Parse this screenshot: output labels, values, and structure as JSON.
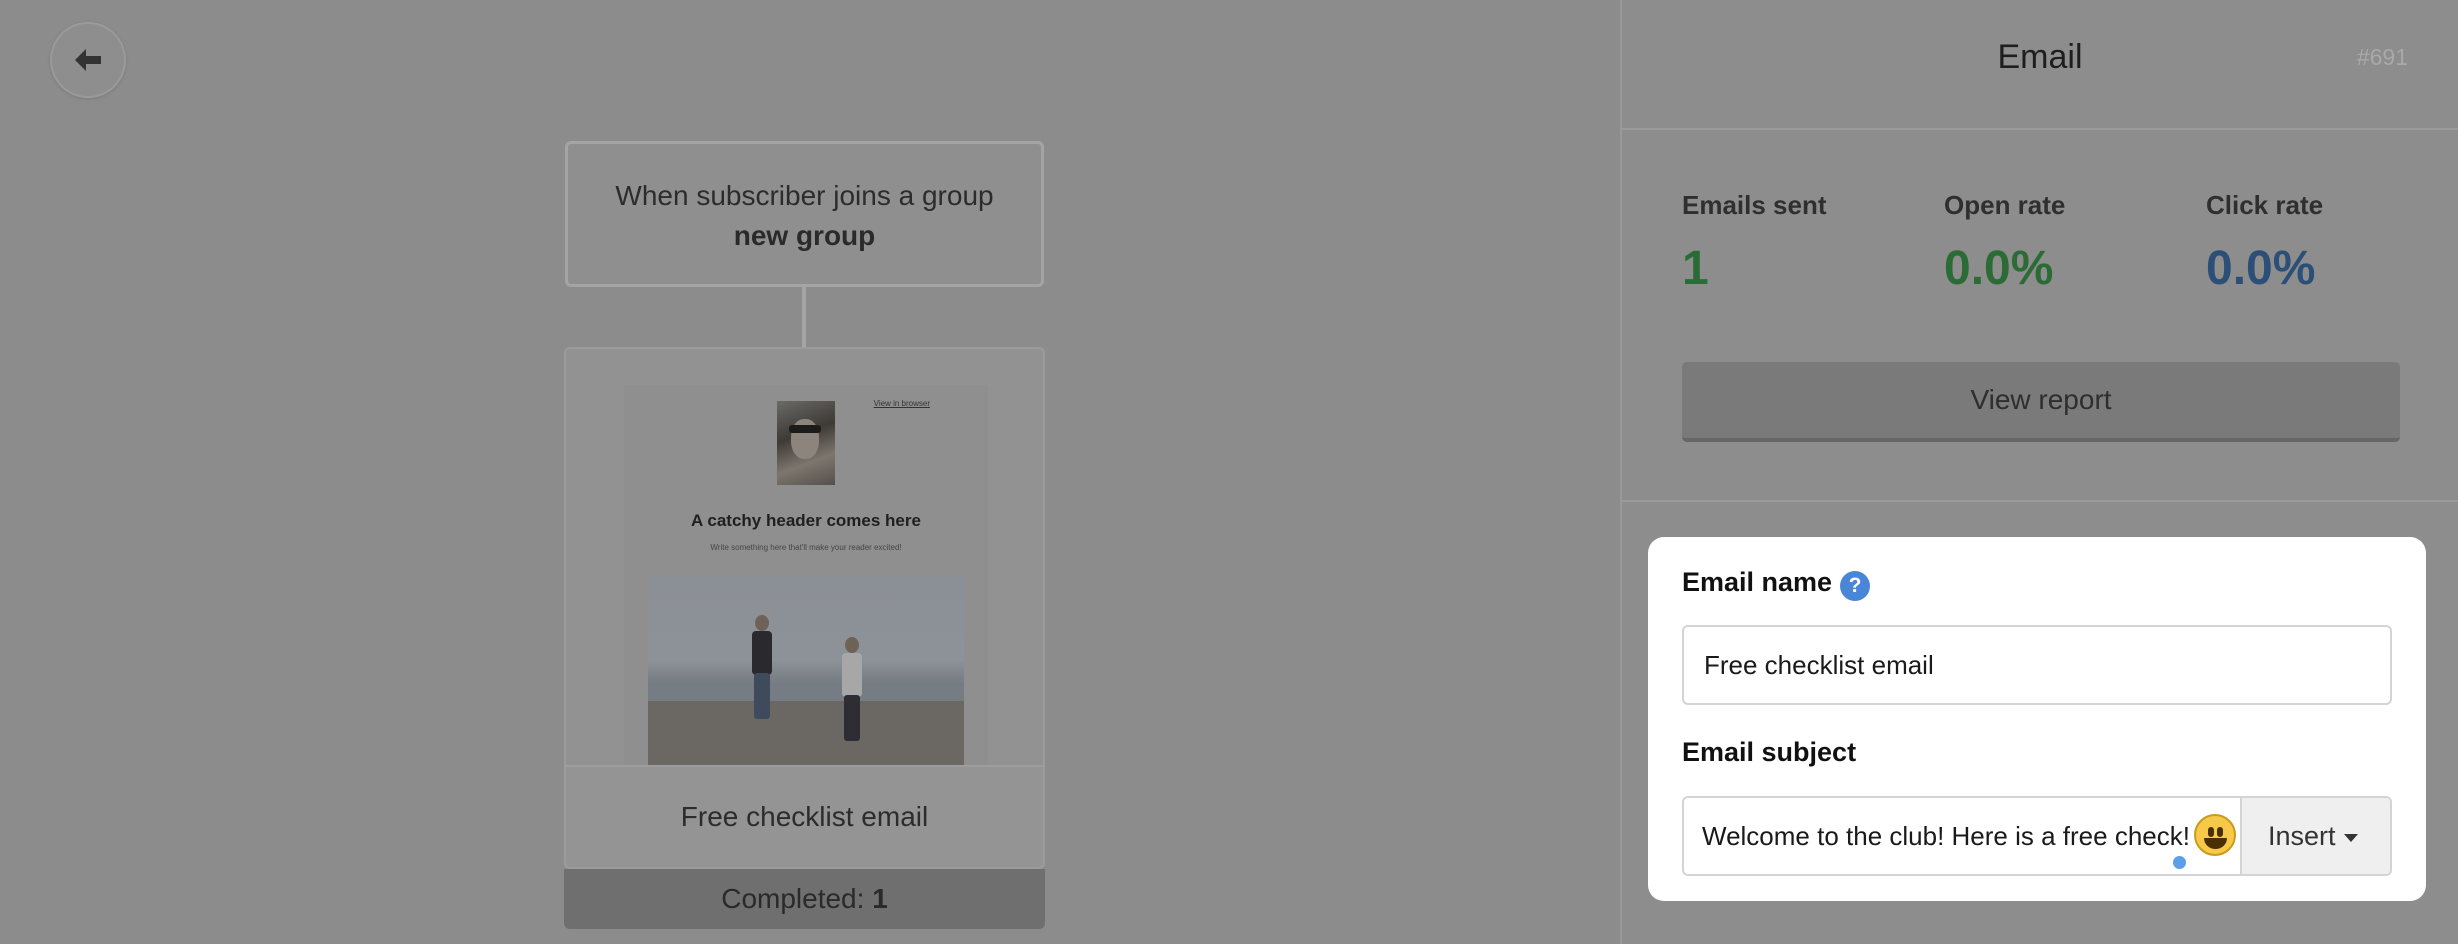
{
  "canvas": {
    "back_icon": "arrow-left-icon",
    "trigger": {
      "line1": "When subscriber joins a group",
      "line2": "new group"
    },
    "email_card": {
      "preview": {
        "browser_link": "View in browser",
        "header": "A catchy header comes here",
        "subheader": "Write something here that'll make your reader excited!"
      },
      "title": "Free checklist email",
      "completed_label": "Completed:",
      "completed_count": "1"
    }
  },
  "panel": {
    "title": "Email",
    "id": "#691",
    "stats": [
      {
        "label": "Emails sent",
        "value": "1",
        "color": "#2b6b35"
      },
      {
        "label": "Open rate",
        "value": "0.0%",
        "color": "#2b6b35"
      },
      {
        "label": "Click rate",
        "value": "0.0%",
        "color": "#2c4f78"
      }
    ],
    "view_report": "View report"
  },
  "form": {
    "email_name_label": "Email name",
    "help_glyph": "?",
    "email_name_value": "Free checklist email",
    "email_subject_label": "Email subject",
    "email_subject_value": "Welcome to the club! Here is a free check!",
    "emoji_icon": "smiley-emoji-icon",
    "insert_label": "Insert"
  }
}
